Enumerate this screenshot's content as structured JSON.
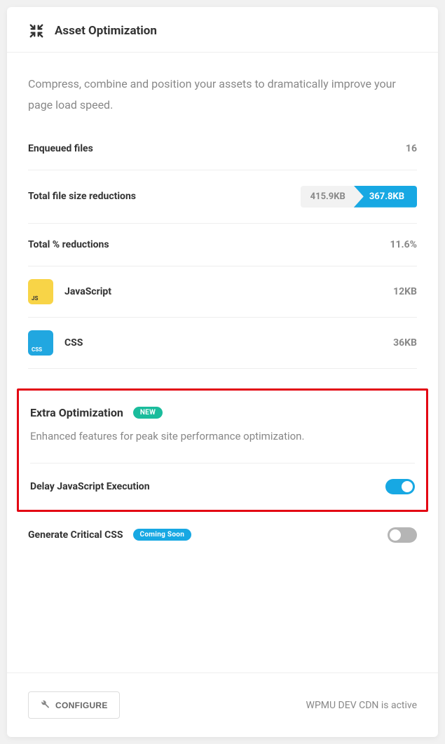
{
  "header": {
    "title": "Asset Optimization"
  },
  "intro": "Compress, combine and position your assets to dramatically improve your page load speed.",
  "stats": {
    "enqueued_label": "Enqueued files",
    "enqueued_value": "16",
    "size_label": "Total file size reductions",
    "size_original": "415.9KB",
    "size_compressed": "367.8KB",
    "pct_label": "Total % reductions",
    "pct_value": "11.6%"
  },
  "assets": {
    "js_label": "JavaScript",
    "js_value": "12KB",
    "js_icon_text": "JS",
    "css_label": "CSS",
    "css_value": "36KB",
    "css_icon_text": "CSS"
  },
  "extra": {
    "heading": "Extra Optimization",
    "badge": "NEW",
    "desc": "Enhanced features for peak site performance optimization.",
    "delay_label": "Delay JavaScript Execution"
  },
  "critical": {
    "label": "Generate Critical CSS",
    "badge": "Coming Soon"
  },
  "footer": {
    "configure": "CONFIGURE",
    "status": "WPMU DEV CDN is active"
  }
}
